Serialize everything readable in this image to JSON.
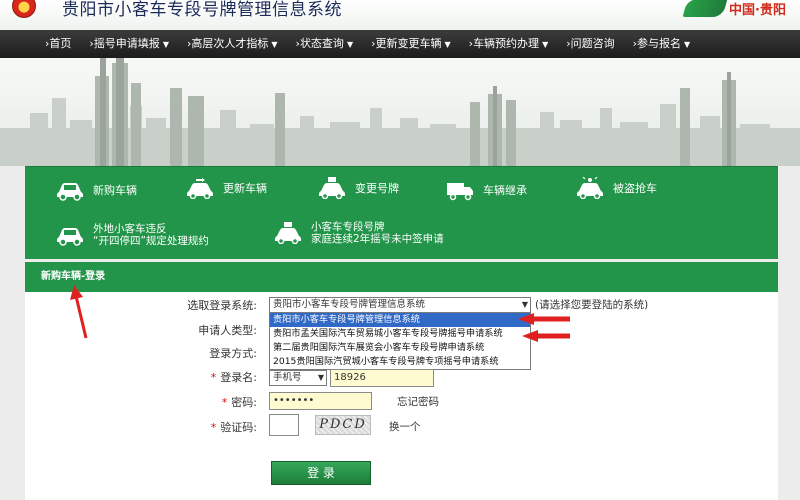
{
  "header": {
    "site_title": "贵阳市小客车专段号牌管理信息系统",
    "brand": "中国·贵阳"
  },
  "nav": [
    {
      "label": "首页",
      "caret": ""
    },
    {
      "label": "摇号申请填报",
      "caret": "▼"
    },
    {
      "label": "高层次人才指标",
      "caret": "▼"
    },
    {
      "label": "状态查询",
      "caret": "▼"
    },
    {
      "label": "更新变更车辆",
      "caret": "▼"
    },
    {
      "label": "车辆预约办理",
      "caret": "▼"
    },
    {
      "label": "问题咨询",
      "caret": ""
    },
    {
      "label": "参与报名",
      "caret": "▼"
    }
  ],
  "nav_separator": "›",
  "services": {
    "new_car": "新购车辆",
    "update_car": "更新车辆",
    "change_plate": "变更号牌",
    "inherit_car": "车辆继承",
    "stolen_car": "被盗抢车",
    "violation_line1": "外地小客车违反",
    "violation_line2": "“开四停四”规定处理规约",
    "family_line1": "小客车专段号牌",
    "family_line2": "家庭连续2年摇号未中签申请"
  },
  "login": {
    "header": "新购车辆-登录",
    "system_label": "选取登录系统:",
    "system_value": "贵阳市小客车专段号牌管理信息系统",
    "system_hint": "(请选择您要登陆的系统)",
    "applicant_label": "申请人类型:",
    "method_label": "登录方式:",
    "login_name_label": "登录名:",
    "login_type_value": "手机号",
    "login_name_value": "18926",
    "password_label": "密码:",
    "password_value": "•••••••",
    "forgot_password": "忘记密码",
    "captcha_label": "验证码:",
    "captcha_value": "",
    "captcha_image_text": "PDCD",
    "refresh_captcha": "换一个",
    "submit": "登 录",
    "required_mark": "*",
    "system_options": [
      "贵阳市小客车专段号牌管理信息系统",
      "贵阳市孟关国际汽车贸易城小客车专段号牌摇号申请系统",
      "第二届贵阳国际汽车展览会小客车专段号牌申请系统",
      "2015贵阳国际汽贸城小客车专段号牌专项摇号申请系统"
    ]
  },
  "colors": {
    "primary_green": "#23954a",
    "nav_bg": "#2a2a2a",
    "annotation_red": "#e02020",
    "selected_option": "#3169c6"
  }
}
